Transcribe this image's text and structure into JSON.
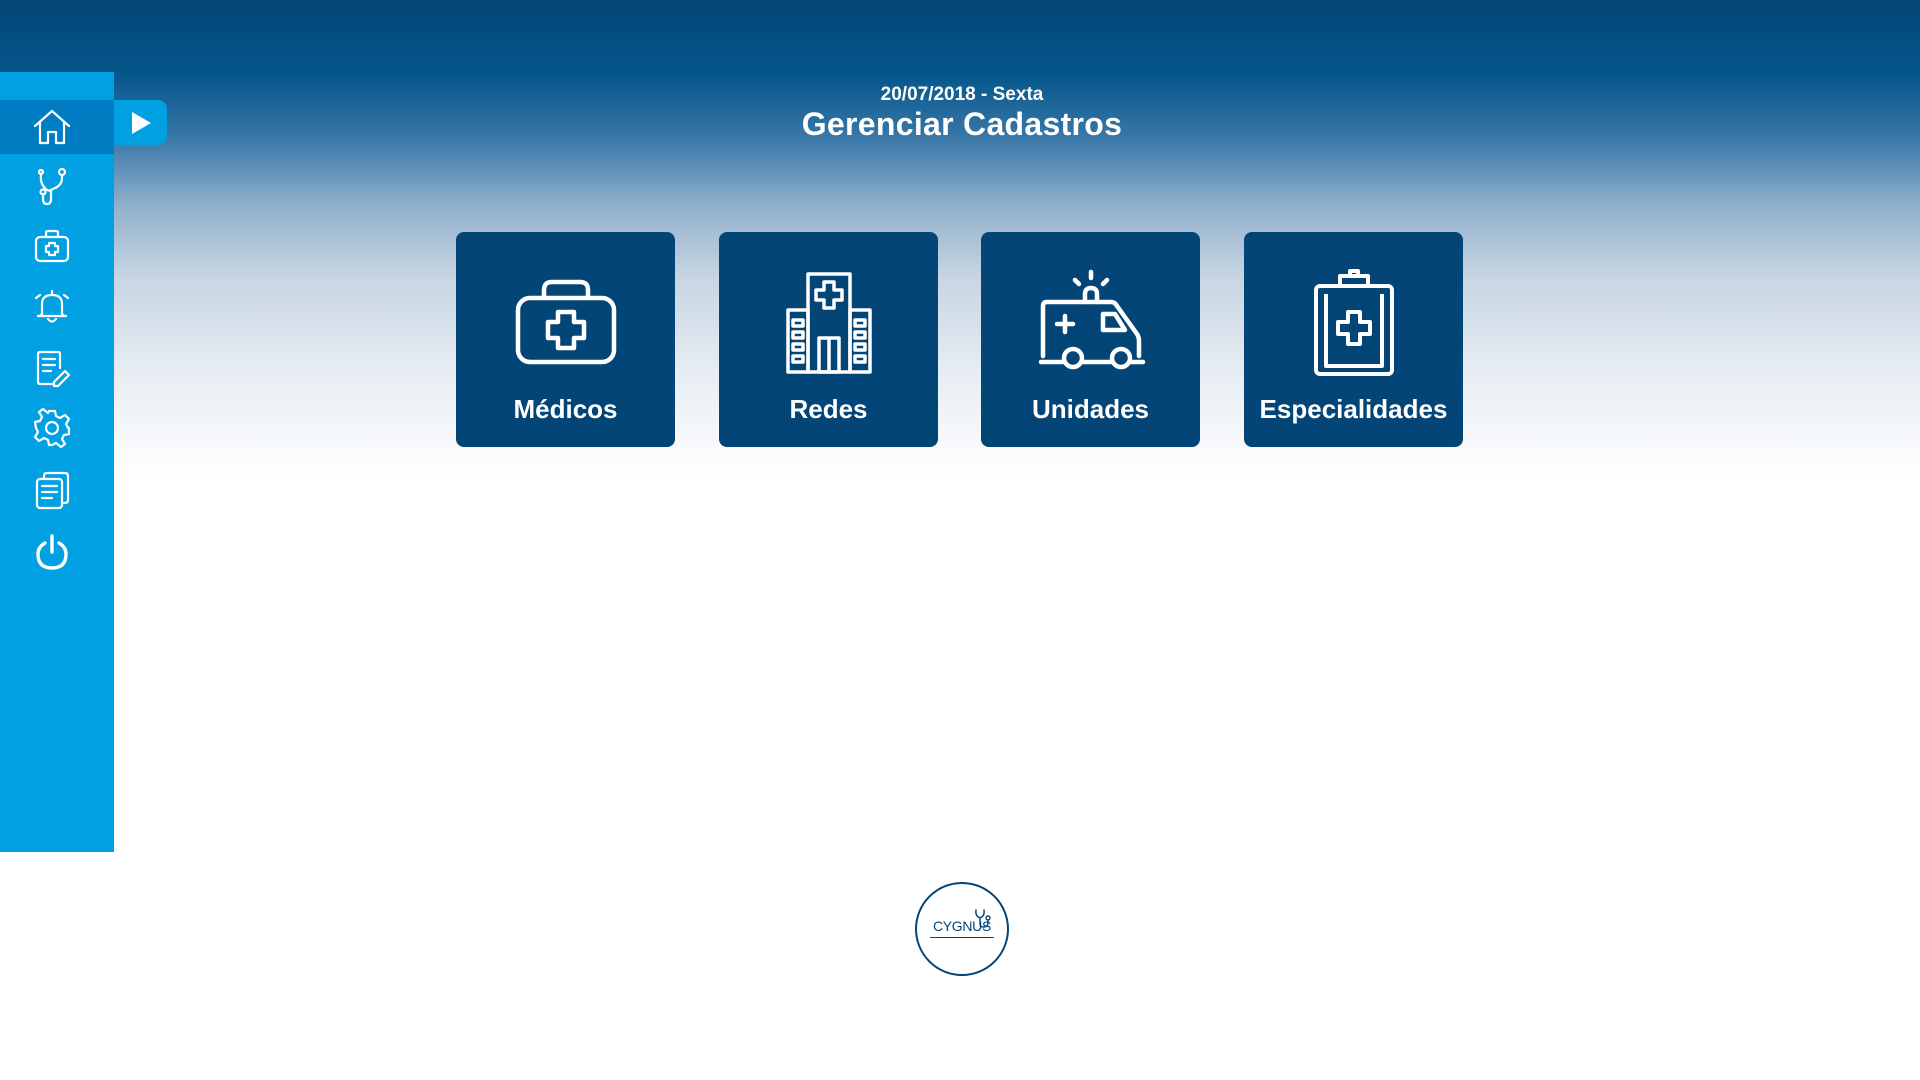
{
  "colors": {
    "header_dark": "#034576",
    "sidebar": "#00a0e3",
    "sidebar_active": "#007cc3",
    "card_bg": "#034576",
    "text_light": "#ffffff"
  },
  "sidebar": {
    "items": [
      {
        "icon": "home-icon",
        "active": true
      },
      {
        "icon": "stethoscope-icon"
      },
      {
        "icon": "medical-kit-icon"
      },
      {
        "icon": "alarm-bell-icon"
      },
      {
        "icon": "edit-document-icon"
      },
      {
        "icon": "gear-icon"
      },
      {
        "icon": "documents-icon"
      },
      {
        "icon": "power-icon"
      }
    ],
    "expand_icon": "play-arrow-icon"
  },
  "header": {
    "date": "20/07/2018 - Sexta",
    "title": "Gerenciar Cadastros"
  },
  "cards": [
    {
      "label": "Médicos",
      "icon": "medical-bag-icon"
    },
    {
      "label": "Redes",
      "icon": "hospital-building-icon"
    },
    {
      "label": "Unidades",
      "icon": "ambulance-icon"
    },
    {
      "label": "Especialidades",
      "icon": "clipboard-cross-icon"
    }
  ],
  "logo": {
    "text": "CYGNUS"
  }
}
